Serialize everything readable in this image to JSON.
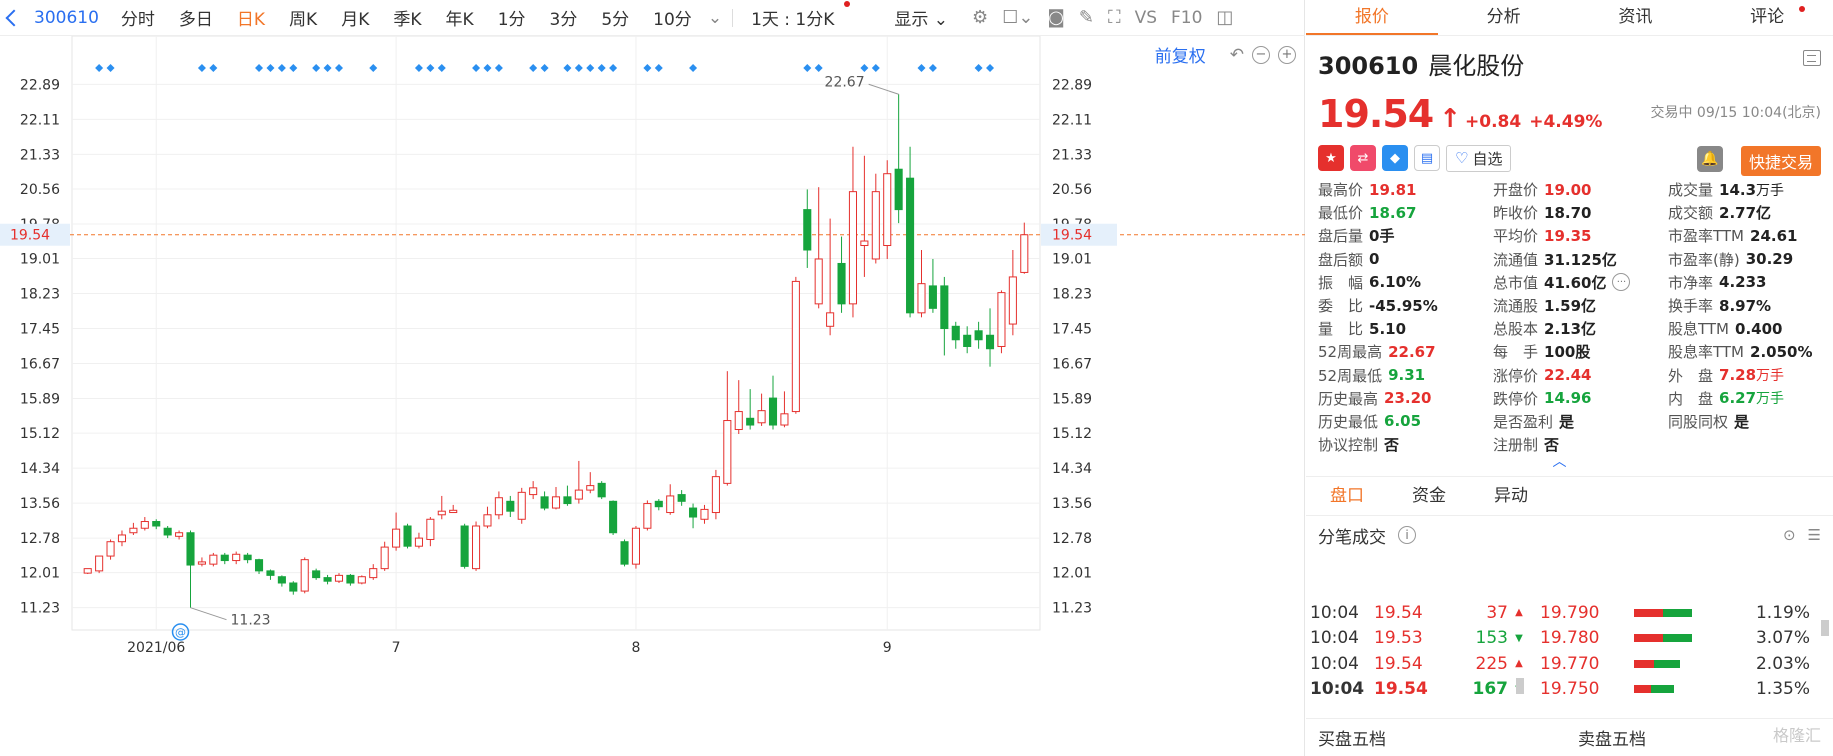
{
  "toolbar": {
    "code": "300610",
    "periods": [
      "分时",
      "多日",
      "日K",
      "周K",
      "月K",
      "季K",
      "年K",
      "1分",
      "3分",
      "5分",
      "10分"
    ],
    "active_period": "日K",
    "period_dropdown": "1天 : 1分K",
    "display_label": "显示",
    "f10_label": "F10"
  },
  "chart": {
    "restore_label": "前复权",
    "price_ticks": [
      "22.89",
      "22.11",
      "21.33",
      "20.56",
      "19.78",
      "19.01",
      "18.23",
      "17.45",
      "16.67",
      "15.89",
      "15.12",
      "14.34",
      "13.56",
      "12.78",
      "12.01",
      "11.23"
    ],
    "current_price_tag": "19.54",
    "high_label": "22.67",
    "low_label": "11.23",
    "date_labels": [
      "2021/06",
      "7",
      "8",
      "9"
    ]
  },
  "chart_data": {
    "type": "candlestick",
    "ylim": [
      11.0,
      23.3
    ],
    "current_price": 19.54,
    "marked_high": 22.67,
    "marked_low": 11.23,
    "candles": [
      [
        12.0,
        12.1,
        12.02,
        11.98
      ],
      [
        12.05,
        12.38,
        12.38,
        12.0
      ],
      [
        12.38,
        12.7,
        12.75,
        12.3
      ],
      [
        12.7,
        12.85,
        12.95,
        12.6
      ],
      [
        12.9,
        13.0,
        13.12,
        12.85
      ],
      [
        13.0,
        13.15,
        13.25,
        12.95
      ],
      [
        13.15,
        13.05,
        13.2,
        12.98
      ],
      [
        13.0,
        12.85,
        13.05,
        12.78
      ],
      [
        12.82,
        12.9,
        12.95,
        12.75
      ],
      [
        12.9,
        12.18,
        12.95,
        11.23
      ],
      [
        12.2,
        12.25,
        12.35,
        12.15
      ],
      [
        12.2,
        12.4,
        12.45,
        12.15
      ],
      [
        12.4,
        12.28,
        12.45,
        12.2
      ],
      [
        12.28,
        12.42,
        12.48,
        12.2
      ],
      [
        12.4,
        12.3,
        12.45,
        12.22
      ],
      [
        12.3,
        12.05,
        12.32,
        11.98
      ],
      [
        12.05,
        11.95,
        12.08,
        11.85
      ],
      [
        11.92,
        11.78,
        11.95,
        11.7
      ],
      [
        11.78,
        11.6,
        11.82,
        11.52
      ],
      [
        11.6,
        12.3,
        12.35,
        11.55
      ],
      [
        12.05,
        11.9,
        12.1,
        11.85
      ],
      [
        11.9,
        11.82,
        11.96,
        11.75
      ],
      [
        11.82,
        11.95,
        12.0,
        11.78
      ],
      [
        11.95,
        11.78,
        11.98,
        11.72
      ],
      [
        11.78,
        11.92,
        11.95,
        11.75
      ],
      [
        11.9,
        12.1,
        12.2,
        11.85
      ],
      [
        12.1,
        12.58,
        12.7,
        12.05
      ],
      [
        12.58,
        12.98,
        13.35,
        12.5
      ],
      [
        13.05,
        12.6,
        13.1,
        12.55
      ],
      [
        12.6,
        12.78,
        12.9,
        12.55
      ],
      [
        12.75,
        13.2,
        13.25,
        12.6
      ],
      [
        13.3,
        13.38,
        13.72,
        13.2
      ],
      [
        13.35,
        13.4,
        13.52,
        13.35
      ],
      [
        13.05,
        12.15,
        13.1,
        12.1
      ],
      [
        12.1,
        13.05,
        13.15,
        12.05
      ],
      [
        13.05,
        13.3,
        13.48,
        13.0
      ],
      [
        13.3,
        13.68,
        13.82,
        13.2
      ],
      [
        13.6,
        13.38,
        13.72,
        13.25
      ],
      [
        13.2,
        13.8,
        13.9,
        13.1
      ],
      [
        13.75,
        13.9,
        14.05,
        13.65
      ],
      [
        13.7,
        13.45,
        13.82,
        13.4
      ],
      [
        13.45,
        13.7,
        13.92,
        13.42
      ],
      [
        13.7,
        13.55,
        13.95,
        13.5
      ],
      [
        13.65,
        13.85,
        14.5,
        13.55
      ],
      [
        13.85,
        13.95,
        14.25,
        13.78
      ],
      [
        14.0,
        13.7,
        14.05,
        13.65
      ],
      [
        13.6,
        12.9,
        13.62,
        12.85
      ],
      [
        12.7,
        12.2,
        12.75,
        12.15
      ],
      [
        12.2,
        13.0,
        13.05,
        12.1
      ],
      [
        13.0,
        13.55,
        13.62,
        12.95
      ],
      [
        13.6,
        13.48,
        13.65,
        13.4
      ],
      [
        13.35,
        13.72,
        13.98,
        13.3
      ],
      [
        13.75,
        13.6,
        13.85,
        13.5
      ],
      [
        13.45,
        13.25,
        13.55,
        13.0
      ],
      [
        13.2,
        13.42,
        13.52,
        13.1
      ],
      [
        13.35,
        14.15,
        14.3,
        13.2
      ],
      [
        14.0,
        15.4,
        16.5,
        13.95
      ],
      [
        15.2,
        15.6,
        16.3,
        15.1
      ],
      [
        15.45,
        15.3,
        16.1,
        15.2
      ],
      [
        15.35,
        15.62,
        16.0,
        15.28
      ],
      [
        15.9,
        15.3,
        16.4,
        15.2
      ],
      [
        15.3,
        15.55,
        16.05,
        15.25
      ],
      [
        15.6,
        18.5,
        18.6,
        15.55
      ],
      [
        20.1,
        19.2,
        20.55,
        18.8
      ],
      [
        18.0,
        19.0,
        20.6,
        17.9
      ],
      [
        17.5,
        17.8,
        19.9,
        17.3
      ],
      [
        18.9,
        18.0,
        19.5,
        17.8
      ],
      [
        18.0,
        20.5,
        21.5,
        17.7
      ],
      [
        19.3,
        19.4,
        21.3,
        18.6
      ],
      [
        19.0,
        20.5,
        20.9,
        18.9
      ],
      [
        19.3,
        20.9,
        21.2,
        19.0
      ],
      [
        21.0,
        20.1,
        22.67,
        19.8
      ],
      [
        20.8,
        17.8,
        21.5,
        17.7
      ],
      [
        17.8,
        18.45,
        19.2,
        17.7
      ],
      [
        18.4,
        17.9,
        19.0,
        17.8
      ],
      [
        18.4,
        17.45,
        18.6,
        16.85
      ],
      [
        17.5,
        17.2,
        17.6,
        17.0
      ],
      [
        17.3,
        17.05,
        17.5,
        16.9
      ],
      [
        17.4,
        17.2,
        17.6,
        17.0
      ],
      [
        17.3,
        17.0,
        17.9,
        16.6
      ],
      [
        17.05,
        18.25,
        18.3,
        16.9
      ],
      [
        17.55,
        18.6,
        19.2,
        17.3
      ],
      [
        18.7,
        19.54,
        19.81,
        18.67
      ]
    ]
  },
  "quote": {
    "tabs": [
      "报价",
      "分析",
      "资讯",
      "评论"
    ],
    "code": "300610",
    "name": "晨化股份",
    "price": "19.54",
    "change": "+0.84",
    "change_pct": "+4.49%",
    "status": "交易中 09/15 10:04(北京)",
    "watch_label": "自选",
    "quick_trade_label": "快捷交易",
    "fields": [
      {
        "label": "最高价",
        "value": "19.81",
        "color": "red"
      },
      {
        "label": "开盘价",
        "value": "19.00",
        "color": "red"
      },
      {
        "label": "成交量",
        "value": "14.3",
        "unit": "万手",
        "color": "black"
      },
      {
        "label": "最低价",
        "value": "18.67",
        "color": "green"
      },
      {
        "label": "昨收价",
        "value": "18.70",
        "color": "black"
      },
      {
        "label": "成交额",
        "value": "2.77亿",
        "color": "black"
      },
      {
        "label": "盘后量",
        "value": "0手",
        "color": "black"
      },
      {
        "label": "平均价",
        "value": "19.35",
        "color": "red"
      },
      {
        "label": "市盈率TTM",
        "value": "24.61",
        "color": "black"
      },
      {
        "label": "盘后额",
        "value": "0",
        "color": "black"
      },
      {
        "label": "流通值",
        "value": "31.125亿",
        "color": "black"
      },
      {
        "label": "市盈率(静)",
        "value": "30.29",
        "color": "black"
      },
      {
        "label": "振　幅",
        "value": "6.10%",
        "color": "black"
      },
      {
        "label": "总市值",
        "value": "41.60亿",
        "color": "black",
        "more": true
      },
      {
        "label": "市净率",
        "value": "4.233",
        "color": "black"
      },
      {
        "label": "委　比",
        "value": "-45.95%",
        "color": "black"
      },
      {
        "label": "流通股",
        "value": "1.59亿",
        "color": "black"
      },
      {
        "label": "换手率",
        "value": "8.97%",
        "color": "black"
      },
      {
        "label": "量　比",
        "value": "5.10",
        "color": "black"
      },
      {
        "label": "总股本",
        "value": "2.13亿",
        "color": "black"
      },
      {
        "label": "股息TTM",
        "value": "0.400",
        "color": "black"
      },
      {
        "label": "52周最高",
        "value": "22.67",
        "color": "red"
      },
      {
        "label": "每　手",
        "value": "100股",
        "color": "black"
      },
      {
        "label": "股息率TTM",
        "value": "2.050%",
        "color": "black"
      },
      {
        "label": "52周最低",
        "value": "9.31",
        "color": "green"
      },
      {
        "label": "涨停价",
        "value": "22.44",
        "color": "red"
      },
      {
        "label": "外　盘",
        "value": "7.28",
        "unit": "万手",
        "color": "red"
      },
      {
        "label": "历史最高",
        "value": "23.20",
        "color": "red"
      },
      {
        "label": "跌停价",
        "value": "14.96",
        "color": "green"
      },
      {
        "label": "内　盘",
        "value": "6.27",
        "unit": "万手",
        "color": "green"
      },
      {
        "label": "历史最低",
        "value": "6.05",
        "color": "green"
      },
      {
        "label": "是否盈利",
        "value": "是",
        "color": "black"
      },
      {
        "label": "同股同权",
        "value": "是",
        "color": "black"
      },
      {
        "label": "协议控制",
        "value": "否",
        "color": "black"
      },
      {
        "label": "注册制",
        "value": "否",
        "color": "black"
      },
      {
        "label": "",
        "value": "",
        "color": "black"
      }
    ],
    "subtabs": [
      "盘口",
      "资金",
      "异动"
    ],
    "trade_title": "分笔成交",
    "ticks": [
      {
        "time": "10:04",
        "price": "19.54",
        "qty": "37",
        "dir": "red"
      },
      {
        "time": "10:04",
        "price": "19.53",
        "qty": "153",
        "dir": "green"
      },
      {
        "time": "10:04",
        "price": "19.54",
        "qty": "225",
        "dir": "red"
      },
      {
        "time": "10:04",
        "price": "19.54",
        "qty": "167",
        "dir": "green"
      }
    ],
    "depth": [
      {
        "price": "19.790",
        "pct": "1.19%",
        "red": 0.5,
        "green": 0.5
      },
      {
        "price": "19.780",
        "pct": "3.07%",
        "red": 0.5,
        "green": 0.5
      },
      {
        "price": "19.770",
        "pct": "2.03%",
        "red": 0.35,
        "green": 0.45
      },
      {
        "price": "19.750",
        "pct": "1.35%",
        "red": 0.3,
        "green": 0.4
      }
    ],
    "buy5_label": "买盘五档",
    "sell5_label": "卖盘五档",
    "watermark": "格隆汇"
  },
  "colors": {
    "up": "#e5302d",
    "down": "#16a43d",
    "accent": "#f27629",
    "link": "#2a6ff0"
  }
}
